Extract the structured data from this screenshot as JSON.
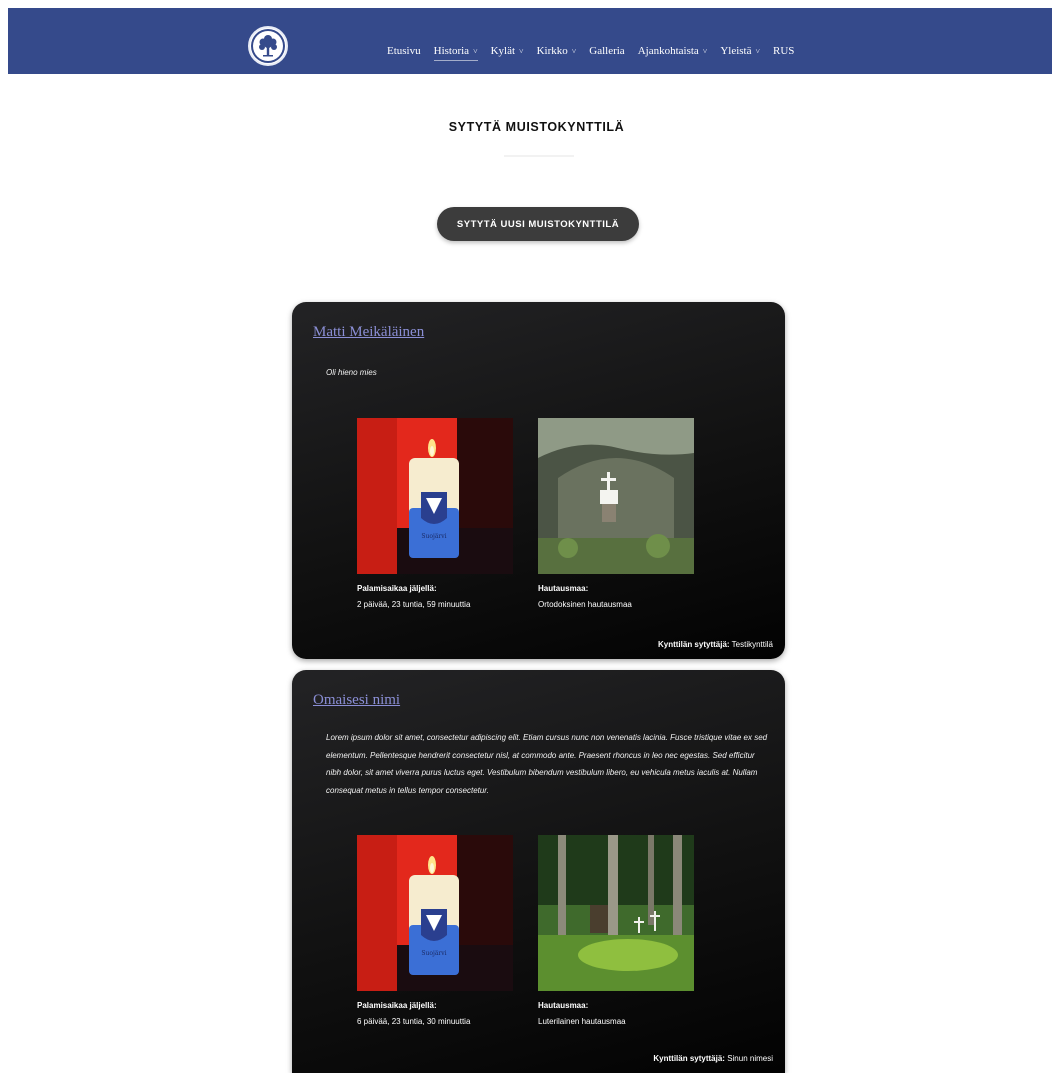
{
  "nav": {
    "items": [
      {
        "label": "Etusivu",
        "dropdown": false
      },
      {
        "label": "Historia",
        "dropdown": true,
        "active": true
      },
      {
        "label": "Kylät",
        "dropdown": true
      },
      {
        "label": "Kirkko",
        "dropdown": true
      },
      {
        "label": "Galleria",
        "dropdown": false
      },
      {
        "label": "Ajankohtaista",
        "dropdown": true
      },
      {
        "label": "Yleistä",
        "dropdown": true
      },
      {
        "label": "RUS",
        "dropdown": false
      }
    ],
    "caret_glyph": "˅"
  },
  "page": {
    "title": "SYTYTÄ MUISTOKYNTTILÄ",
    "cta_label": "SYTYTÄ UUSI MUISTOKYNTTILÄ"
  },
  "cards": [
    {
      "name": "Matti Meikäläinen",
      "message": "Oli hieno mies",
      "burn_label": "Palamisaikaa jäljellä:",
      "burn_value": "2 päivää, 23 tuntia, 59 minuuttia",
      "cemetery_label": "Hautausmaa:",
      "cemetery_value": "Ortodoksinen hautausmaa",
      "lighter_label": "Kynttilän sytyttäjä:",
      "lighter_value": "Testikynttilä"
    },
    {
      "name": "Omaisesi nimi",
      "message": "Lorem ipsum dolor sit amet, consectetur adipiscing elit. Etiam cursus nunc non venenatis lacinia. Fusce tristique vitae ex sed elementum. Pellentesque hendrerit consectetur nisl, at commodo ante. Praesent rhoncus in leo nec egestas. Sed efficitur nibh dolor, sit amet viverra purus luctus eget. Vestibulum bibendum vestibulum libero, eu vehicula metus iaculis at. Nullam consequat metus in tellus tempor consectetur.",
      "burn_label": "Palamisaikaa jäljellä:",
      "burn_value": "6 päivää, 23 tuntia, 30 minuuttia",
      "cemetery_label": "Hautausmaa:",
      "cemetery_value": "Luterilainen hautausmaa",
      "lighter_label": "Kynttilän sytyttäjä:",
      "lighter_value": "Sinun nimesi"
    }
  ],
  "candle_label": "Suojärvi",
  "colors": {
    "navbar": "#354a8b",
    "card_bg": "#111111",
    "link": "#8b8fd6",
    "button": "#3c3c3c"
  },
  "icons": [
    "tree-logo-icon",
    "chevron-down-icon",
    "candle-photo",
    "grave-photo"
  ]
}
